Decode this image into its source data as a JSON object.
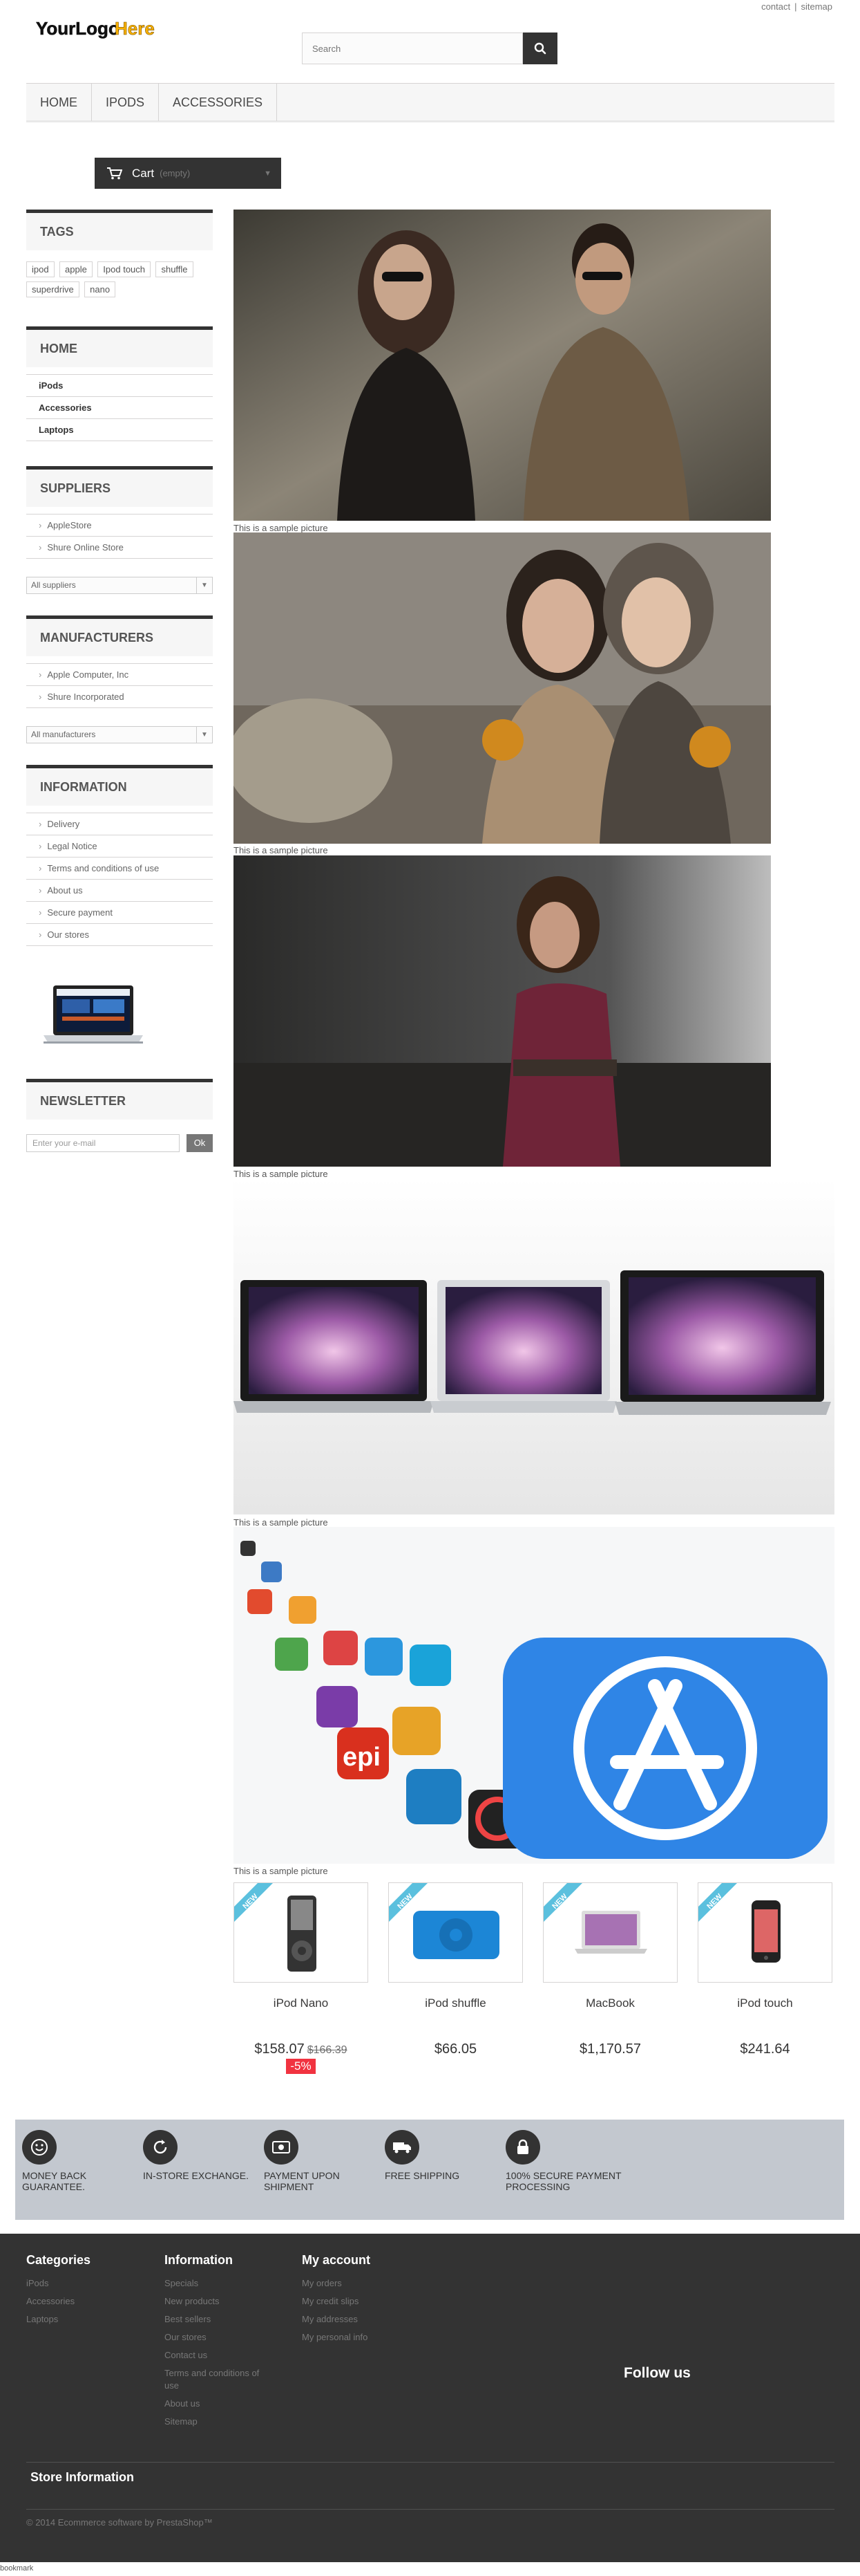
{
  "header": {
    "top_links": [
      "contact",
      "sitemap"
    ],
    "logo_text": "YourLogoHere",
    "search_placeholder": "Search"
  },
  "menu": [
    "HOME",
    "IPODS",
    "ACCESSORIES"
  ],
  "cart": {
    "label": "Cart",
    "qty": "(empty)"
  },
  "tags": {
    "title": "TAGS",
    "items": [
      "ipod",
      "apple",
      "Ipod touch",
      "shuffle",
      "superdrive",
      "nano"
    ]
  },
  "categories": {
    "title": "HOME",
    "items": [
      "iPods",
      "Accessories",
      "Laptops"
    ]
  },
  "suppliers": {
    "title": "SUPPLIERS",
    "items": [
      "AppleStore",
      "Shure Online Store"
    ],
    "select": "All suppliers"
  },
  "manufacturers": {
    "title": "MANUFACTURERS",
    "items": [
      "Apple Computer, Inc",
      "Shure Incorporated"
    ],
    "select": "All manufacturers"
  },
  "information": {
    "title": "INFORMATION",
    "items": [
      "Delivery",
      "Legal Notice",
      "Terms and conditions of use",
      "About us",
      "Secure payment",
      "Our stores"
    ]
  },
  "newsletter": {
    "title": "NEWSLETTER",
    "placeholder": "Enter your e-mail",
    "button": "Ok"
  },
  "captions": [
    "This is a sample picture",
    "This is a sample picture",
    "This is a sample picture",
    "This is a sample picture",
    "This is a sample picture"
  ],
  "products": [
    {
      "name": "iPod Nano",
      "price": "$158.07",
      "old_price": "$166.39",
      "discount": "-5%",
      "badge": "NEW"
    },
    {
      "name": "iPod shuffle",
      "price": "$66.05",
      "badge": "NEW"
    },
    {
      "name": "MacBook",
      "price": "$1,170.57",
      "badge": "NEW"
    },
    {
      "name": "iPod touch",
      "price": "$241.64",
      "badge": "NEW"
    }
  ],
  "reassurance": [
    {
      "text": "MONEY BACK GUARANTEE.",
      "icon": "smile-icon"
    },
    {
      "text": "IN-STORE EXCHANGE.",
      "icon": "refresh-icon"
    },
    {
      "text": "PAYMENT UPON SHIPMENT",
      "icon": "cash-icon"
    },
    {
      "text": "FREE SHIPPING",
      "icon": "truck-icon"
    },
    {
      "text": "100% SECURE PAYMENT PROCESSING",
      "icon": "lock-icon"
    }
  ],
  "footer": {
    "categories": {
      "title": "Categories",
      "items": [
        "iPods",
        "Accessories",
        "Laptops"
      ]
    },
    "information": {
      "title": "Information",
      "items": [
        "Specials",
        "New products",
        "Best sellers",
        "Our stores",
        "Contact us",
        "Terms and conditions of use",
        "About us",
        "Sitemap"
      ]
    },
    "account": {
      "title": "My account",
      "items": [
        "My orders",
        "My credit slips",
        "My addresses",
        "My personal info"
      ]
    },
    "follow": "Follow us",
    "store_info": "Store Information",
    "copyright": "© 2014 Ecommerce software by PrestaShop™"
  },
  "status_bar": "bookmark",
  "colors": {
    "dark": "#333333",
    "accent_blue": "#5bc0de",
    "discount_red": "#f13340",
    "reassure_bg": "#c3c8cf"
  }
}
